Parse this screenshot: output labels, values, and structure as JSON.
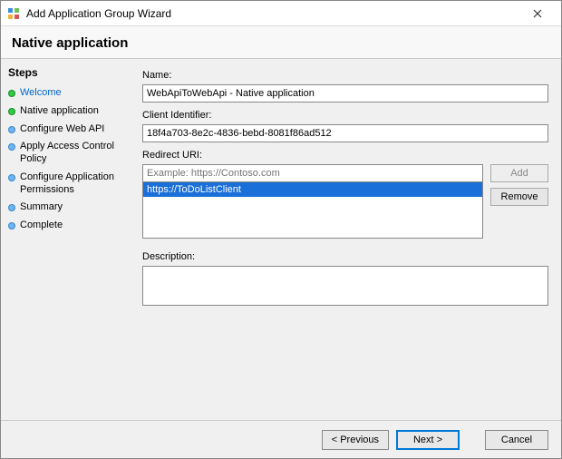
{
  "titlebar": {
    "title": "Add Application Group Wizard"
  },
  "page": {
    "heading": "Native application"
  },
  "sidebar": {
    "title": "Steps",
    "items": [
      {
        "label": "Welcome",
        "state": "done",
        "active": true
      },
      {
        "label": "Native application",
        "state": "done",
        "active": false
      },
      {
        "label": "Configure Web API",
        "state": "pending",
        "active": false
      },
      {
        "label": "Apply Access Control Policy",
        "state": "pending",
        "active": false
      },
      {
        "label": "Configure Application Permissions",
        "state": "pending",
        "active": false
      },
      {
        "label": "Summary",
        "state": "pending",
        "active": false
      },
      {
        "label": "Complete",
        "state": "pending",
        "active": false
      }
    ]
  },
  "form": {
    "name_label": "Name:",
    "name_value": "WebApiToWebApi - Native application",
    "client_id_label": "Client Identifier:",
    "client_id_value": "18f4a703-8e2c-4836-bebd-8081f86ad512",
    "redirect_label": "Redirect URI:",
    "redirect_placeholder": "Example: https://Contoso.com",
    "redirect_input_value": "",
    "redirect_items": [
      "https://ToDoListClient"
    ],
    "add_button": "Add",
    "remove_button": "Remove",
    "description_label": "Description:",
    "description_value": ""
  },
  "footer": {
    "previous": "< Previous",
    "next": "Next >",
    "cancel": "Cancel"
  }
}
